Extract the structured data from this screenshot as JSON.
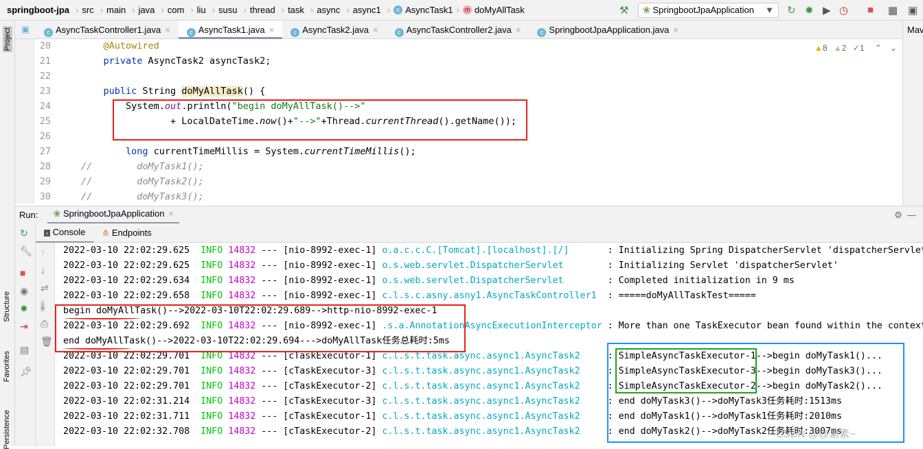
{
  "breadcrumb": {
    "project": "springboot-jpa",
    "items": [
      "src",
      "main",
      "java",
      "com",
      "liu",
      "susu",
      "thread",
      "task",
      "async",
      "async1"
    ],
    "class": "AsyncTask1",
    "method": "doMyAllTask"
  },
  "toolbar": {
    "run_config": "SpringbootJpaApplication"
  },
  "sidebar": {
    "project": "Project",
    "structure": "Structure",
    "favorites": "Favorites",
    "persistence": "Persistence"
  },
  "tabs": [
    "AsyncTaskController1.java",
    "AsyncTask1.java",
    "AsyncTask2.java",
    "AsyncTaskController2.java",
    "SpringbootJpaApplication.java"
  ],
  "active_tab": "AsyncTask1.java",
  "maven": "Mav",
  "inspections": {
    "warnings": "8",
    "weak_warnings": "2",
    "typos": "1"
  },
  "editor": {
    "lines": [
      {
        "n": "20",
        "parts": [
          {
            "c": "ann",
            "t": "    @Autowired"
          }
        ]
      },
      {
        "n": "21",
        "parts": [
          {
            "c": "kw",
            "t": "    private "
          },
          {
            "c": "",
            "t": "AsyncTask2 asyncTask2;"
          }
        ]
      },
      {
        "n": "22",
        "parts": []
      },
      {
        "n": "23",
        "parts": [
          {
            "c": "kw",
            "t": "    public "
          },
          {
            "c": "",
            "t": "String "
          },
          {
            "c": "hl",
            "t": "doMyAllTask"
          },
          {
            "c": "",
            "t": "() {"
          }
        ]
      },
      {
        "n": "24",
        "parts": [
          {
            "c": "",
            "t": "        System."
          },
          {
            "c": "fld",
            "t": "out"
          },
          {
            "c": "",
            "t": ".println("
          },
          {
            "c": "str",
            "t": "\"begin doMyAllTask()-->\""
          }
        ]
      },
      {
        "n": "25",
        "parts": [
          {
            "c": "",
            "t": "                + LocalDateTime."
          },
          {
            "c": "it",
            "t": "now"
          },
          {
            "c": "",
            "t": "()+"
          },
          {
            "c": "str",
            "t": "\"-->\""
          },
          {
            "c": "",
            "t": "+Thread."
          },
          {
            "c": "it",
            "t": "currentThread"
          },
          {
            "c": "",
            "t": "().getName());"
          }
        ]
      },
      {
        "n": "26",
        "parts": []
      },
      {
        "n": "27",
        "parts": [
          {
            "c": "kw",
            "t": "        long "
          },
          {
            "c": "",
            "t": "currentTimeMillis = System."
          },
          {
            "c": "it",
            "t": "currentTimeMillis"
          },
          {
            "c": "",
            "t": "();"
          }
        ]
      },
      {
        "n": "28",
        "parts": [
          {
            "c": "cmt",
            "t": "//        doMyTask1();"
          }
        ]
      },
      {
        "n": "29",
        "parts": [
          {
            "c": "cmt",
            "t": "//        doMyTask2();"
          }
        ]
      },
      {
        "n": "30",
        "parts": [
          {
            "c": "cmt",
            "t": "//        doMyTask3();"
          }
        ]
      }
    ]
  },
  "run": {
    "label": "Run:",
    "config": "SpringbootJpaApplication",
    "console_tab": "Console",
    "endpoints_tab": "Endpoints"
  },
  "console": [
    {
      "ts": "2022-03-10 22:02:29.625",
      "lvl": "INFO",
      "pid": "14832",
      "th": "--- [nio-8992-exec-1]",
      "lg": "o.a.c.c.C.[Tomcat].[localhost].[/]",
      "msg": ": Initializing Spring DispatcherServlet 'dispatcherServlet'"
    },
    {
      "ts": "2022-03-10 22:02:29.625",
      "lvl": "INFO",
      "pid": "14832",
      "th": "--- [nio-8992-exec-1]",
      "lg": "o.s.web.servlet.DispatcherServlet",
      "msg": ": Initializing Servlet 'dispatcherServlet'"
    },
    {
      "ts": "2022-03-10 22:02:29.634",
      "lvl": "INFO",
      "pid": "14832",
      "th": "--- [nio-8992-exec-1]",
      "lg": "o.s.web.servlet.DispatcherServlet",
      "msg": ": Completed initialization in 9 ms"
    },
    {
      "ts": "2022-03-10 22:02:29.658",
      "lvl": "INFO",
      "pid": "14832",
      "th": "--- [nio-8992-exec-1]",
      "lg": "c.l.s.c.asny.asny1.AsyncTaskController1",
      "msg": ": =====doMyAllTaskTest====="
    },
    {
      "plain": "begin doMyAllTask()-->2022-03-10T22:02:29.689-->http-nio-8992-exec-1"
    },
    {
      "ts": "2022-03-10 22:02:29.692",
      "lvl": "INFO",
      "pid": "14832",
      "th": "--- [nio-8992-exec-1]",
      "lg": ".s.a.AnnotationAsyncExecutionInterceptor",
      "msg": ": More than one TaskExecutor bean found within the context"
    },
    {
      "plain": "end doMyAllTask()-->2022-03-10T22:02:29.694--->doMyAllTask任务总耗时:5ms"
    },
    {
      "ts": "2022-03-10 22:02:29.701",
      "lvl": "INFO",
      "pid": "14832",
      "th": "--- [cTaskExecutor-1]",
      "lg": "c.l.s.t.task.async.async1.AsyncTask2",
      "msg": ": SimpleAsyncTaskExecutor-1-->begin doMyTask1()..."
    },
    {
      "ts": "2022-03-10 22:02:29.701",
      "lvl": "INFO",
      "pid": "14832",
      "th": "--- [cTaskExecutor-3]",
      "lg": "c.l.s.t.task.async.async1.AsyncTask2",
      "msg": ": SimpleAsyncTaskExecutor-3-->begin doMyTask3()..."
    },
    {
      "ts": "2022-03-10 22:02:29.701",
      "lvl": "INFO",
      "pid": "14832",
      "th": "--- [cTaskExecutor-2]",
      "lg": "c.l.s.t.task.async.async1.AsyncTask2",
      "msg": ": SimpleAsyncTaskExecutor-2-->begin doMyTask2()..."
    },
    {
      "ts": "2022-03-10 22:02:31.214",
      "lvl": "INFO",
      "pid": "14832",
      "th": "--- [cTaskExecutor-3]",
      "lg": "c.l.s.t.task.async.async1.AsyncTask2",
      "msg": ": end doMyTask3()-->doMyTask3任务耗时:1513ms"
    },
    {
      "ts": "2022-03-10 22:02:31.711",
      "lvl": "INFO",
      "pid": "14832",
      "th": "--- [cTaskExecutor-1]",
      "lg": "c.l.s.t.task.async.async1.AsyncTask2",
      "msg": ": end doMyTask1()-->doMyTask1任务耗时:2010ms"
    },
    {
      "ts": "2022-03-10 22:02:32.708",
      "lvl": "INFO",
      "pid": "14832",
      "th": "--- [cTaskExecutor-2]",
      "lg": "c.l.s.t.task.async.async1.AsyncTask2",
      "msg": ": end doMyTask2()-->doMyTask2任务耗时:3007ms"
    }
  ],
  "watermark": "CSDN @@素素~",
  "colors": {
    "red_box": "#e8201a",
    "green_box": "#1aa51a",
    "blue_box": "#1e90ff"
  }
}
